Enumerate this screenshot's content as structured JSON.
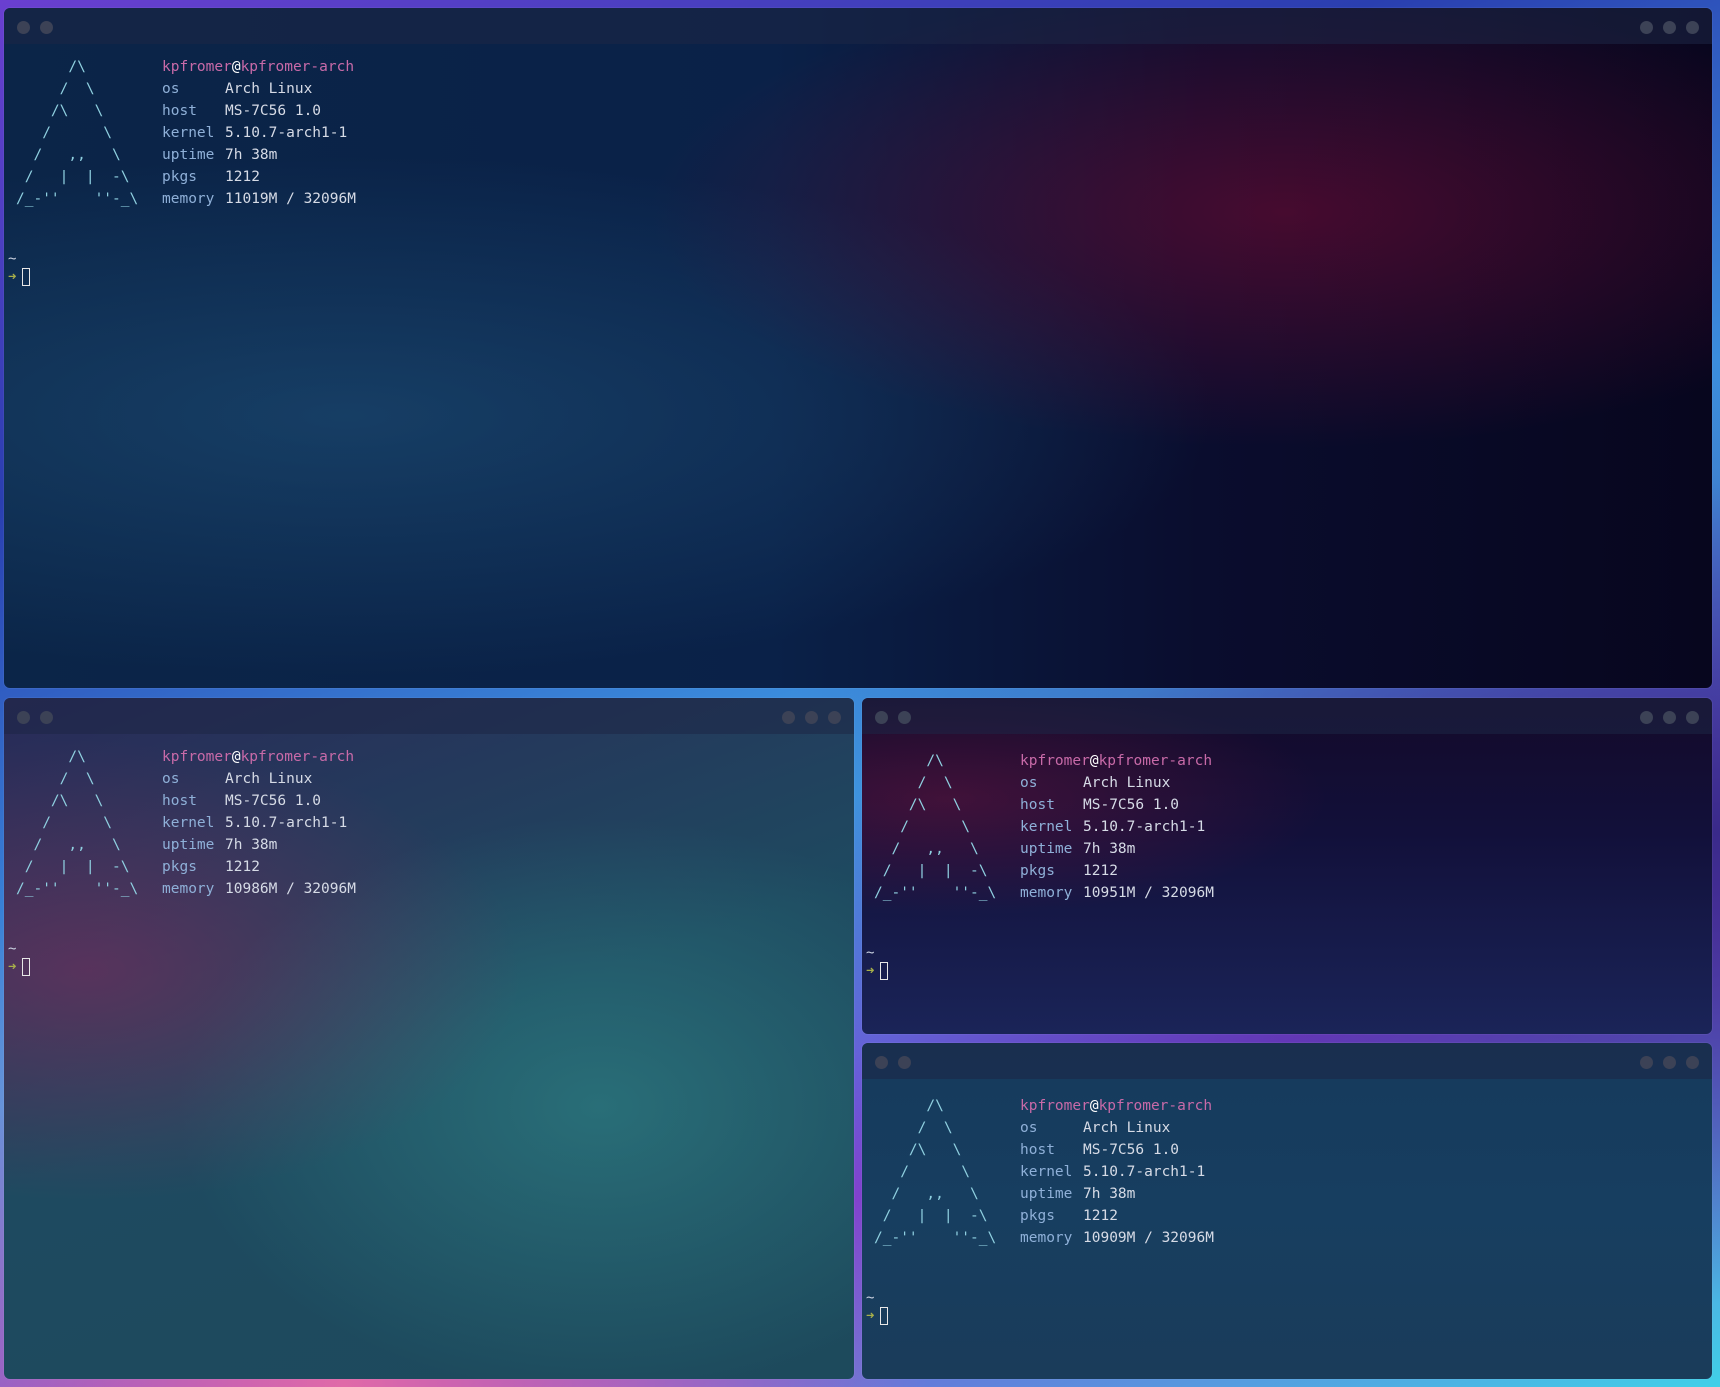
{
  "colors": {
    "username": "#c86aa8",
    "hostname": "#c86aa8",
    "at_sign": "#ffffff",
    "keys": "#8fb0d8",
    "values": "#d6dbe6",
    "logo": "#8fd0e0",
    "prompt_arrow": "#a8b04a"
  },
  "logo_lines": [
    "      /\\",
    "     /  \\",
    "    /\\   \\",
    "   /      \\",
    "  /   ,,   \\",
    " /   |  |  -\\",
    "/_-''    ''-_\\"
  ],
  "prompt": {
    "tilde": "~",
    "arrow": "➜"
  },
  "terminals": [
    {
      "user": "kpfromer",
      "at": "@",
      "host": "kpfromer-arch",
      "rows": [
        {
          "key": "os",
          "value": "Arch Linux"
        },
        {
          "key": "host",
          "value": "MS-7C56 1.0"
        },
        {
          "key": "kernel",
          "value": "5.10.7-arch1-1"
        },
        {
          "key": "uptime",
          "value": "7h 38m"
        },
        {
          "key": "pkgs",
          "value": "1212"
        },
        {
          "key": "memory",
          "value": "11019M / 32096M"
        }
      ]
    },
    {
      "user": "kpfromer",
      "at": "@",
      "host": "kpfromer-arch",
      "rows": [
        {
          "key": "os",
          "value": "Arch Linux"
        },
        {
          "key": "host",
          "value": "MS-7C56 1.0"
        },
        {
          "key": "kernel",
          "value": "5.10.7-arch1-1"
        },
        {
          "key": "uptime",
          "value": "7h 38m"
        },
        {
          "key": "pkgs",
          "value": "1212"
        },
        {
          "key": "memory",
          "value": "10986M / 32096M"
        }
      ]
    },
    {
      "user": "kpfromer",
      "at": "@",
      "host": "kpfromer-arch",
      "rows": [
        {
          "key": "os",
          "value": "Arch Linux"
        },
        {
          "key": "host",
          "value": "MS-7C56 1.0"
        },
        {
          "key": "kernel",
          "value": "5.10.7-arch1-1"
        },
        {
          "key": "uptime",
          "value": "7h 38m"
        },
        {
          "key": "pkgs",
          "value": "1212"
        },
        {
          "key": "memory",
          "value": "10951M / 32096M"
        }
      ]
    },
    {
      "user": "kpfromer",
      "at": "@",
      "host": "kpfromer-arch",
      "rows": [
        {
          "key": "os",
          "value": "Arch Linux"
        },
        {
          "key": "host",
          "value": "MS-7C56 1.0"
        },
        {
          "key": "kernel",
          "value": "5.10.7-arch1-1"
        },
        {
          "key": "uptime",
          "value": "7h 38m"
        },
        {
          "key": "pkgs",
          "value": "1212"
        },
        {
          "key": "memory",
          "value": "10909M / 32096M"
        }
      ]
    }
  ]
}
